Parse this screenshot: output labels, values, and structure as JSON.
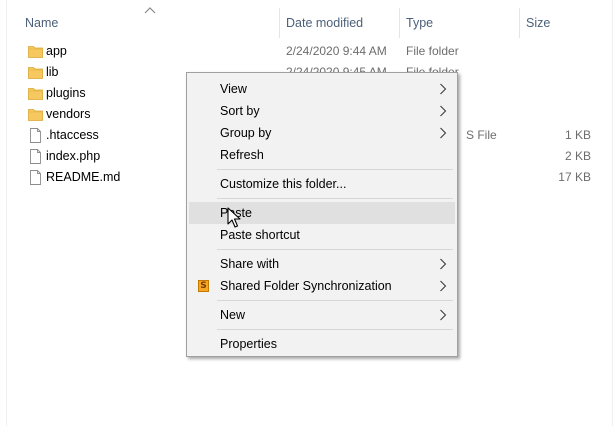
{
  "columns": {
    "name": "Name",
    "date_modified": "Date modified",
    "type": "Type",
    "size": "Size"
  },
  "files": [
    {
      "name": "app",
      "icon": "folder-icon",
      "date": "2/24/2020 9:44 AM",
      "type": "File folder",
      "size": ""
    },
    {
      "name": "lib",
      "icon": "folder-icon",
      "date": "2/24/2020 9:45 AM",
      "type": "File folder",
      "size": ""
    },
    {
      "name": "plugins",
      "icon": "folder-icon",
      "date": "",
      "type": "",
      "size": ""
    },
    {
      "name": "vendors",
      "icon": "folder-icon",
      "date": "",
      "type": "",
      "size": ""
    },
    {
      "name": ".htaccess",
      "icon": "file-icon",
      "date": "",
      "type": "S File",
      "size": "1 KB"
    },
    {
      "name": "index.php",
      "icon": "file-icon",
      "date": "",
      "type": "",
      "size": "2 KB"
    },
    {
      "name": "README.md",
      "icon": "file-icon",
      "date": "",
      "type": "",
      "size": "17 KB"
    }
  ],
  "context_menu": {
    "view": "View",
    "sort_by": "Sort by",
    "group_by": "Group by",
    "refresh": "Refresh",
    "customize": "Customize this folder...",
    "paste": "Paste",
    "paste_shortcut": "Paste shortcut",
    "share_with": "Share with",
    "shared_folder_sync": "Shared Folder Synchronization",
    "new": "New",
    "properties": "Properties"
  },
  "icons": {
    "sync_icon_letter": "S",
    "sync_icon_color": "#f5a623",
    "folder_color": "#f6c85f"
  },
  "colors": {
    "header_text": "#4c607a",
    "menu_background": "#f2f2f2",
    "menu_highlight": "#e0e0e0"
  }
}
